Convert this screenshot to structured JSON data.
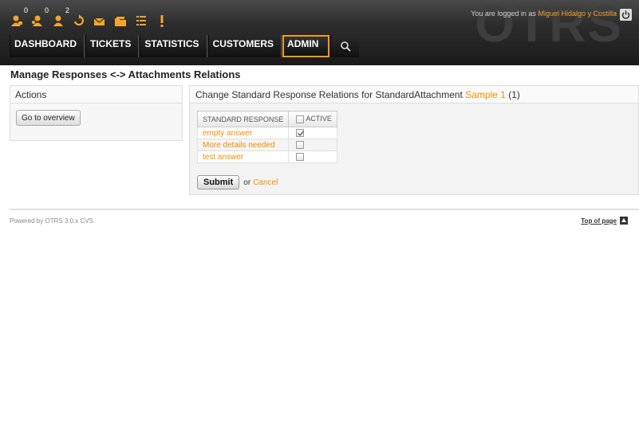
{
  "header": {
    "logo_text": "OTRS",
    "toolbar": [
      {
        "icon": "locked-tickets-icon",
        "count": "0"
      },
      {
        "icon": "watched-tickets-icon",
        "count": "0"
      },
      {
        "icon": "responsible-tickets-icon",
        "count": "2"
      },
      {
        "icon": "refresh-icon",
        "count": ""
      },
      {
        "icon": "email-icon",
        "count": ""
      },
      {
        "icon": "folder-icon",
        "count": ""
      },
      {
        "icon": "list-icon",
        "count": ""
      },
      {
        "icon": "escalation-icon",
        "count": ""
      }
    ],
    "login_prefix": "You are logged in as",
    "user_name": "Miguel Hidalgo y Costilla"
  },
  "nav": {
    "items": [
      "DASHBOARD",
      "TICKETS",
      "STATISTICS",
      "CUSTOMERS",
      "ADMIN"
    ],
    "selected": "ADMIN"
  },
  "page_title": "Manage Responses <-> Attachments Relations",
  "sidebar": {
    "heading": "Actions",
    "goto_button": "Go to overview"
  },
  "content": {
    "heading_prefix": "Change Standard Response Relations for StandardAttachment",
    "attachment_link": "Sample 1",
    "attachment_id": "(1)",
    "table": {
      "col_response": "STANDARD RESPONSE",
      "col_active": "ACTIVE",
      "rows": [
        {
          "name": "empty answer",
          "active": true
        },
        {
          "name": "More details needed",
          "active": false
        },
        {
          "name": "test answer",
          "active": false
        }
      ]
    },
    "submit_label": "Submit",
    "or_text": "or",
    "cancel_label": "Cancel"
  },
  "footer": {
    "powered_by": "Powered by OTRS 3.0.x CVS",
    "top_of_page": "Top of page"
  },
  "colors": {
    "accent": "#f09000",
    "selected_nav_border": "#f29a18",
    "header_bg": "#1a1a1a"
  }
}
